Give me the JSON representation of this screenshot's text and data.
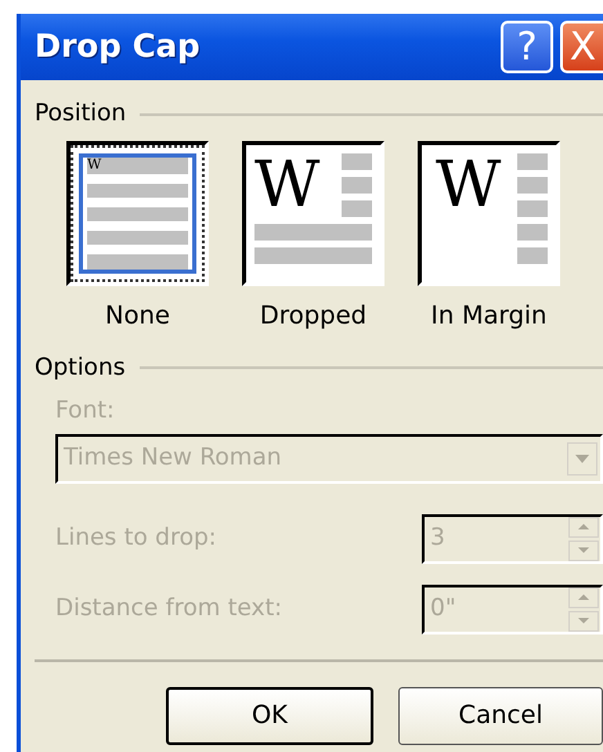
{
  "window": {
    "title": "Drop Cap",
    "controls": [
      {
        "kind": "help",
        "glyph": "?"
      },
      {
        "kind": "close",
        "glyph": "X"
      }
    ]
  },
  "position": {
    "label": "Position",
    "options": [
      {
        "label": "None",
        "kind": "none",
        "glyph": "W",
        "selected": true
      },
      {
        "label": "Dropped",
        "kind": "dropped",
        "glyph": "W",
        "selected": false
      },
      {
        "label": "In Margin",
        "kind": "margin",
        "glyph": "W",
        "selected": false
      }
    ]
  },
  "options": {
    "label": "Options",
    "disabled": true,
    "font": {
      "label": "Font:",
      "value": "Times New Roman"
    },
    "spinners": [
      {
        "label": "Lines to drop:",
        "value": "3"
      },
      {
        "label": "Distance from text:",
        "value": "0\""
      }
    ]
  },
  "buttons": [
    {
      "label": "OK",
      "default": true
    },
    {
      "label": "Cancel",
      "default": false
    }
  ]
}
